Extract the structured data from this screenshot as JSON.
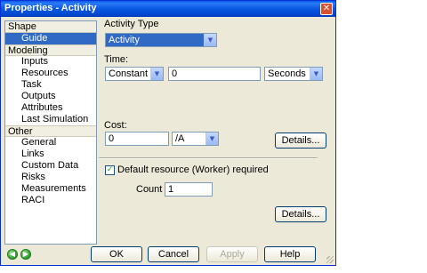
{
  "window": {
    "title": "Properties - Activity",
    "close_glyph": "✕"
  },
  "nav": {
    "groups": [
      {
        "label": "Shape",
        "items": [
          "Guide"
        ]
      },
      {
        "label": "Modeling",
        "items": [
          "Inputs",
          "Resources",
          "Task",
          "Outputs",
          "Attributes",
          "Last Simulation"
        ]
      },
      {
        "label": "Other",
        "items": [
          "General",
          "Links",
          "Custom Data",
          "Risks",
          "Measurements",
          "RACI"
        ]
      }
    ],
    "selected": "Guide",
    "back_glyph": "◀",
    "forward_glyph": "▶"
  },
  "form": {
    "activity_type_label": "Activity Type",
    "activity_type_value": "Activity",
    "time_label": "Time:",
    "time_distribution": "Constant",
    "time_value": "0",
    "time_unit": "Seconds",
    "cost_label": "Cost:",
    "cost_value": "0",
    "cost_unit": "/A",
    "details_label": "Details...",
    "default_resource_label": "Default resource (Worker) required",
    "default_resource_checked": true,
    "check_glyph": "✓",
    "count_label": "Count",
    "count_value": "1",
    "details2_label": "Details..."
  },
  "buttons": {
    "ok": "OK",
    "cancel": "Cancel",
    "apply": "Apply",
    "help": "Help"
  },
  "icons": {
    "dropdown": "chevron-down-icon"
  },
  "colors": {
    "title_bar": "#0a58e0",
    "selection": "#316ac5",
    "dialog_bg": "#ece9d8"
  }
}
